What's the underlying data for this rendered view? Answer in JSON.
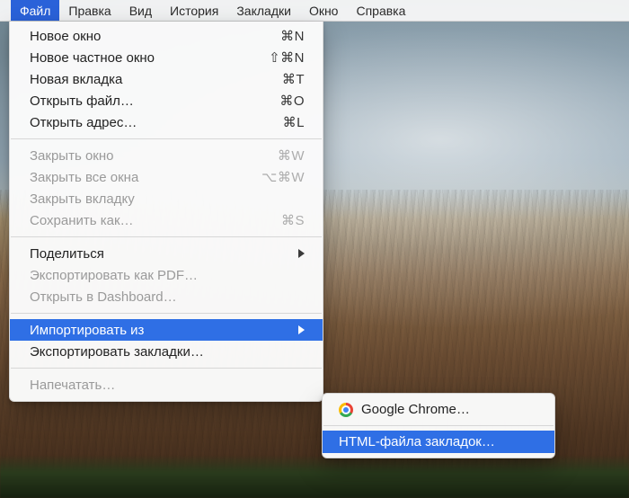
{
  "menubar": {
    "items": [
      {
        "label": "Файл",
        "active": true
      },
      {
        "label": "Правка"
      },
      {
        "label": "Вид"
      },
      {
        "label": "История"
      },
      {
        "label": "Закладки"
      },
      {
        "label": "Окно"
      },
      {
        "label": "Справка"
      }
    ]
  },
  "menu": {
    "items": [
      {
        "label": "Новое окно",
        "shortcut": "⌘N"
      },
      {
        "label": "Новое частное окно",
        "shortcut": "⇧⌘N"
      },
      {
        "label": "Новая вкладка",
        "shortcut": "⌘T"
      },
      {
        "label": "Открыть файл…",
        "shortcut": "⌘O"
      },
      {
        "label": "Открыть адрес…",
        "shortcut": "⌘L"
      },
      {
        "sep": true
      },
      {
        "label": "Закрыть окно",
        "shortcut": "⌘W",
        "disabled": true
      },
      {
        "label": "Закрыть все окна",
        "shortcut": "⌥⌘W",
        "disabled": true
      },
      {
        "label": "Закрыть вкладку",
        "disabled": true
      },
      {
        "label": "Сохранить как…",
        "shortcut": "⌘S",
        "disabled": true
      },
      {
        "sep": true
      },
      {
        "label": "Поделиться",
        "submenu": true
      },
      {
        "label": "Экспортировать как PDF…",
        "disabled": true
      },
      {
        "label": "Открыть в Dashboard…",
        "disabled": true
      },
      {
        "sep": true
      },
      {
        "label": "Импортировать из",
        "submenu": true,
        "highlight": true
      },
      {
        "label": "Экспортировать закладки…"
      },
      {
        "sep": true
      },
      {
        "label": "Напечатать…",
        "disabled": true
      }
    ]
  },
  "submenu": {
    "items": [
      {
        "label": "Google Chrome…",
        "icon": "chrome"
      },
      {
        "sep": true
      },
      {
        "label": "HTML-файла закладок…",
        "highlight": true
      }
    ]
  }
}
